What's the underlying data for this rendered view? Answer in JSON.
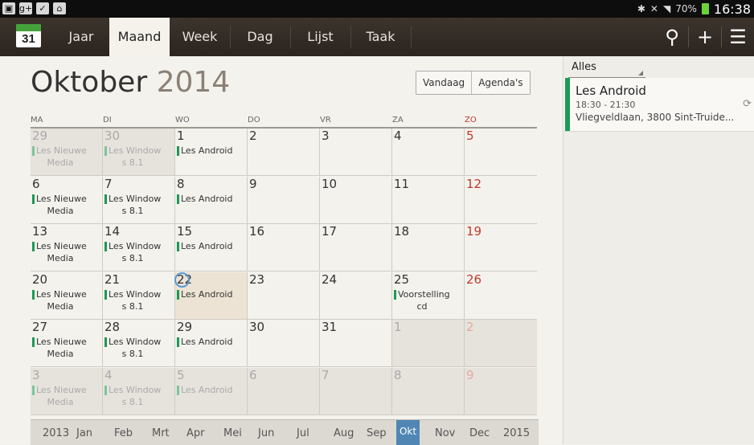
{
  "status_bar": {
    "time": "16:38",
    "battery": "70%"
  },
  "app_icon": {
    "day": "31"
  },
  "tabs": [
    {
      "label": "Jaar"
    },
    {
      "label": "Maand"
    },
    {
      "label": "Week"
    },
    {
      "label": "Dag"
    },
    {
      "label": "Lijst"
    },
    {
      "label": "Taak"
    }
  ],
  "header": {
    "month": "Oktober",
    "year": "2014"
  },
  "buttons": {
    "today": "Vandaag",
    "calendars": "Agenda's"
  },
  "weekdays": [
    "MA",
    "DI",
    "WO",
    "DO",
    "VR",
    "ZA",
    "ZO"
  ],
  "weeks": [
    [
      {
        "d": "29",
        "m": true,
        "e": "Les Nieuwe",
        "e2": "Media"
      },
      {
        "d": "30",
        "m": true,
        "e": "Les Window",
        "e2": "s 8.1"
      },
      {
        "d": "1",
        "e": "Les Android"
      },
      {
        "d": "2"
      },
      {
        "d": "3"
      },
      {
        "d": "4"
      },
      {
        "d": "5",
        "s": true
      }
    ],
    [
      {
        "d": "6",
        "e": "Les Nieuwe",
        "e2": "Media"
      },
      {
        "d": "7",
        "e": "Les Window",
        "e2": "s 8.1"
      },
      {
        "d": "8",
        "e": "Les Android"
      },
      {
        "d": "9"
      },
      {
        "d": "10"
      },
      {
        "d": "11"
      },
      {
        "d": "12",
        "s": true
      }
    ],
    [
      {
        "d": "13",
        "e": "Les Nieuwe",
        "e2": "Media"
      },
      {
        "d": "14",
        "e": "Les Window",
        "e2": "s 8.1"
      },
      {
        "d": "15",
        "e": "Les Android"
      },
      {
        "d": "16"
      },
      {
        "d": "17"
      },
      {
        "d": "18"
      },
      {
        "d": "19",
        "s": true
      }
    ],
    [
      {
        "d": "20",
        "e": "Les Nieuwe",
        "e2": "Media"
      },
      {
        "d": "21",
        "e": "Les Window",
        "e2": "s 8.1"
      },
      {
        "d": "22",
        "t": true,
        "e": "Les Android"
      },
      {
        "d": "23"
      },
      {
        "d": "24"
      },
      {
        "d": "25",
        "e": "Voorstelling",
        "e2": "cd"
      },
      {
        "d": "26",
        "s": true
      }
    ],
    [
      {
        "d": "27",
        "e": "Les Nieuwe",
        "e2": "Media"
      },
      {
        "d": "28",
        "e": "Les Window",
        "e2": "s 8.1"
      },
      {
        "d": "29",
        "e": "Les Android"
      },
      {
        "d": "30"
      },
      {
        "d": "31"
      },
      {
        "d": "1",
        "m": true
      },
      {
        "d": "2",
        "m": true,
        "s": true
      }
    ],
    [
      {
        "d": "3",
        "m": true,
        "e": "Les Nieuwe",
        "e2": "Media"
      },
      {
        "d": "4",
        "m": true,
        "e": "Les Window",
        "e2": "s 8.1"
      },
      {
        "d": "5",
        "m": true,
        "e": "Les Android"
      },
      {
        "d": "6",
        "m": true
      },
      {
        "d": "7",
        "m": true
      },
      {
        "d": "8",
        "m": true
      },
      {
        "d": "9",
        "m": true,
        "s": true
      }
    ]
  ],
  "month_strip": [
    {
      "label": "2013"
    },
    {
      "label": "Jan"
    },
    {
      "label": "Feb"
    },
    {
      "label": "Mrt"
    },
    {
      "label": "Apr"
    },
    {
      "label": "Mei"
    },
    {
      "label": "Jun"
    },
    {
      "label": "Jul"
    },
    {
      "label": "Aug"
    },
    {
      "label": "Sep"
    },
    {
      "label": "Okt",
      "selected": true
    },
    {
      "label": "Nov"
    },
    {
      "label": "Dec"
    },
    {
      "label": "2015"
    }
  ],
  "side": {
    "filter": "Alles",
    "event": {
      "title": "Les Android",
      "time": "18:30 - 21:30",
      "location": "Vliegveldlaan, 3800 Sint-Truide..."
    }
  },
  "colors": {
    "accent": "#1a9b55",
    "sunday": "#c0392b",
    "selected": "#4f86b4"
  }
}
